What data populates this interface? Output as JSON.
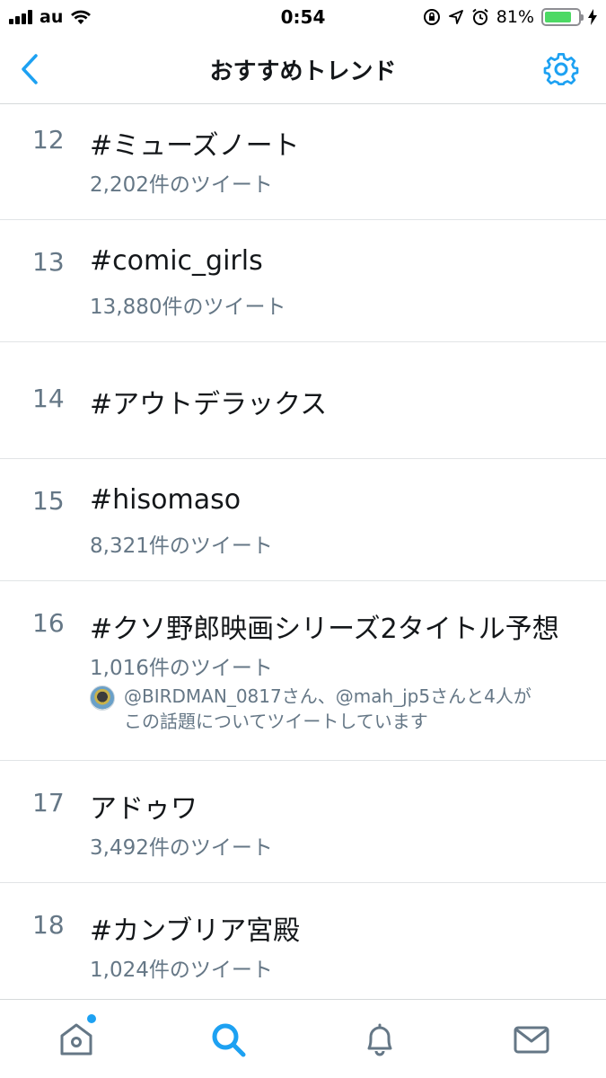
{
  "status_bar": {
    "carrier": "au",
    "time": "0:54",
    "battery": "81%",
    "battery_level": 0.81
  },
  "nav": {
    "title": "おすすめトレンド",
    "back_icon": "chevron-left-icon",
    "settings_icon": "gear-icon"
  },
  "colors": {
    "accent": "#1da1f2",
    "secondary_text": "#657786",
    "primary_text": "#14171a",
    "battery_green": "#4cd964"
  },
  "trends": [
    {
      "rank": "12",
      "name": "#ミューズノート",
      "count": "2,202件のツイート"
    },
    {
      "rank": "13",
      "name": "#comic_girls",
      "count": "13,880件のツイート"
    },
    {
      "rank": "14",
      "name": "#アウトデラックス"
    },
    {
      "rank": "15",
      "name": "#hisomaso",
      "count": "8,321件のツイート"
    },
    {
      "rank": "16",
      "name": "#クソ野郎映画シリーズ2タイトル予想",
      "count": "1,016件のツイート",
      "context_line1": "@BIRDMAN_0817さん、@mah_jp5さんと4人が",
      "context_line2": "この話題についてツイートしています"
    },
    {
      "rank": "17",
      "name": "アドゥワ",
      "count": "3,492件のツイート"
    },
    {
      "rank": "18",
      "name": "#カンブリア宮殿",
      "count": "1,024件のツイート"
    }
  ],
  "tab_bar": {
    "items": [
      "home-icon",
      "search-icon",
      "bell-icon",
      "mail-icon"
    ],
    "active": "search-icon"
  }
}
